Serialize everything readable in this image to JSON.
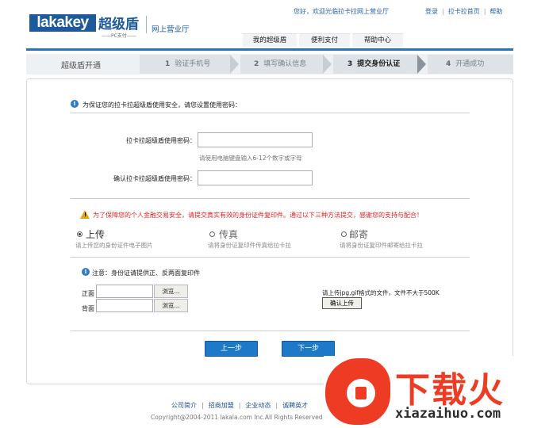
{
  "header": {
    "logo_en": "lakakey",
    "logo_cn": "超级盾",
    "logo_sub": "——PC支付——",
    "site_name": "网上营业厅",
    "welcome": "您好，欢迎光临拉卡拉网上营业厅",
    "links": [
      "登录",
      "拉卡拉首页",
      "帮助"
    ],
    "nav_tabs": [
      "我的超级盾",
      "便利支付",
      "帮助中心"
    ]
  },
  "steps": {
    "title": "超级盾开通",
    "items": [
      {
        "num": "1",
        "label": "验证手机号"
      },
      {
        "num": "2",
        "label": "填写确认信息"
      },
      {
        "num": "3",
        "label": "提交身份认证"
      },
      {
        "num": "4",
        "label": "开通成功"
      }
    ]
  },
  "form": {
    "intro": "为保证您的拉卡拉超级盾使用安全，请您设置使用密码：",
    "password_label": "拉卡拉超级盾使用密码：",
    "password_hint": "请使用电脑键盘输入6-12个数字或字母",
    "confirm_label": "确认拉卡拉超级盾使用密码："
  },
  "warning": {
    "mark": "!",
    "text": "为了保障您的个人金融交易安全，请提交真实有效的身份证件复印件。通过以下三种方法提交，感谢您的支持与配合！"
  },
  "options": [
    {
      "title": "上传",
      "desc": "请上传您的身份证件电子图片",
      "checked": true
    },
    {
      "title": "传真",
      "desc": "请将身份证复印件传真给拉卡拉",
      "checked": false
    },
    {
      "title": "邮寄",
      "desc": "请将身份证复印件邮寄给拉卡拉",
      "checked": false
    }
  ],
  "upload": {
    "note": "注意：身份证请提供正、反两面复印件",
    "front_label": "正面",
    "back_label": "背面",
    "browse_label": "浏览...",
    "format_hint": "请上传jpg,gif格式的文件，文件不大于500K",
    "confirm_upload": "确认上传"
  },
  "buttons": {
    "prev": "上一步",
    "next": "下一步"
  },
  "footer": {
    "links": [
      "公司简介",
      "招商加盟",
      "企业动态",
      "诚聘英才"
    ],
    "copyright": "Copyright@2004-2011 lakala.com Inc.All Rights Reserved"
  },
  "watermark": {
    "text": "下载火",
    "url": "xiazaihuo.com"
  },
  "colors": {
    "brand_blue": "#1c5a9c",
    "accent_blue": "#2474be",
    "warning_red": "#dd2222",
    "watermark_red": "#ee3b24"
  }
}
